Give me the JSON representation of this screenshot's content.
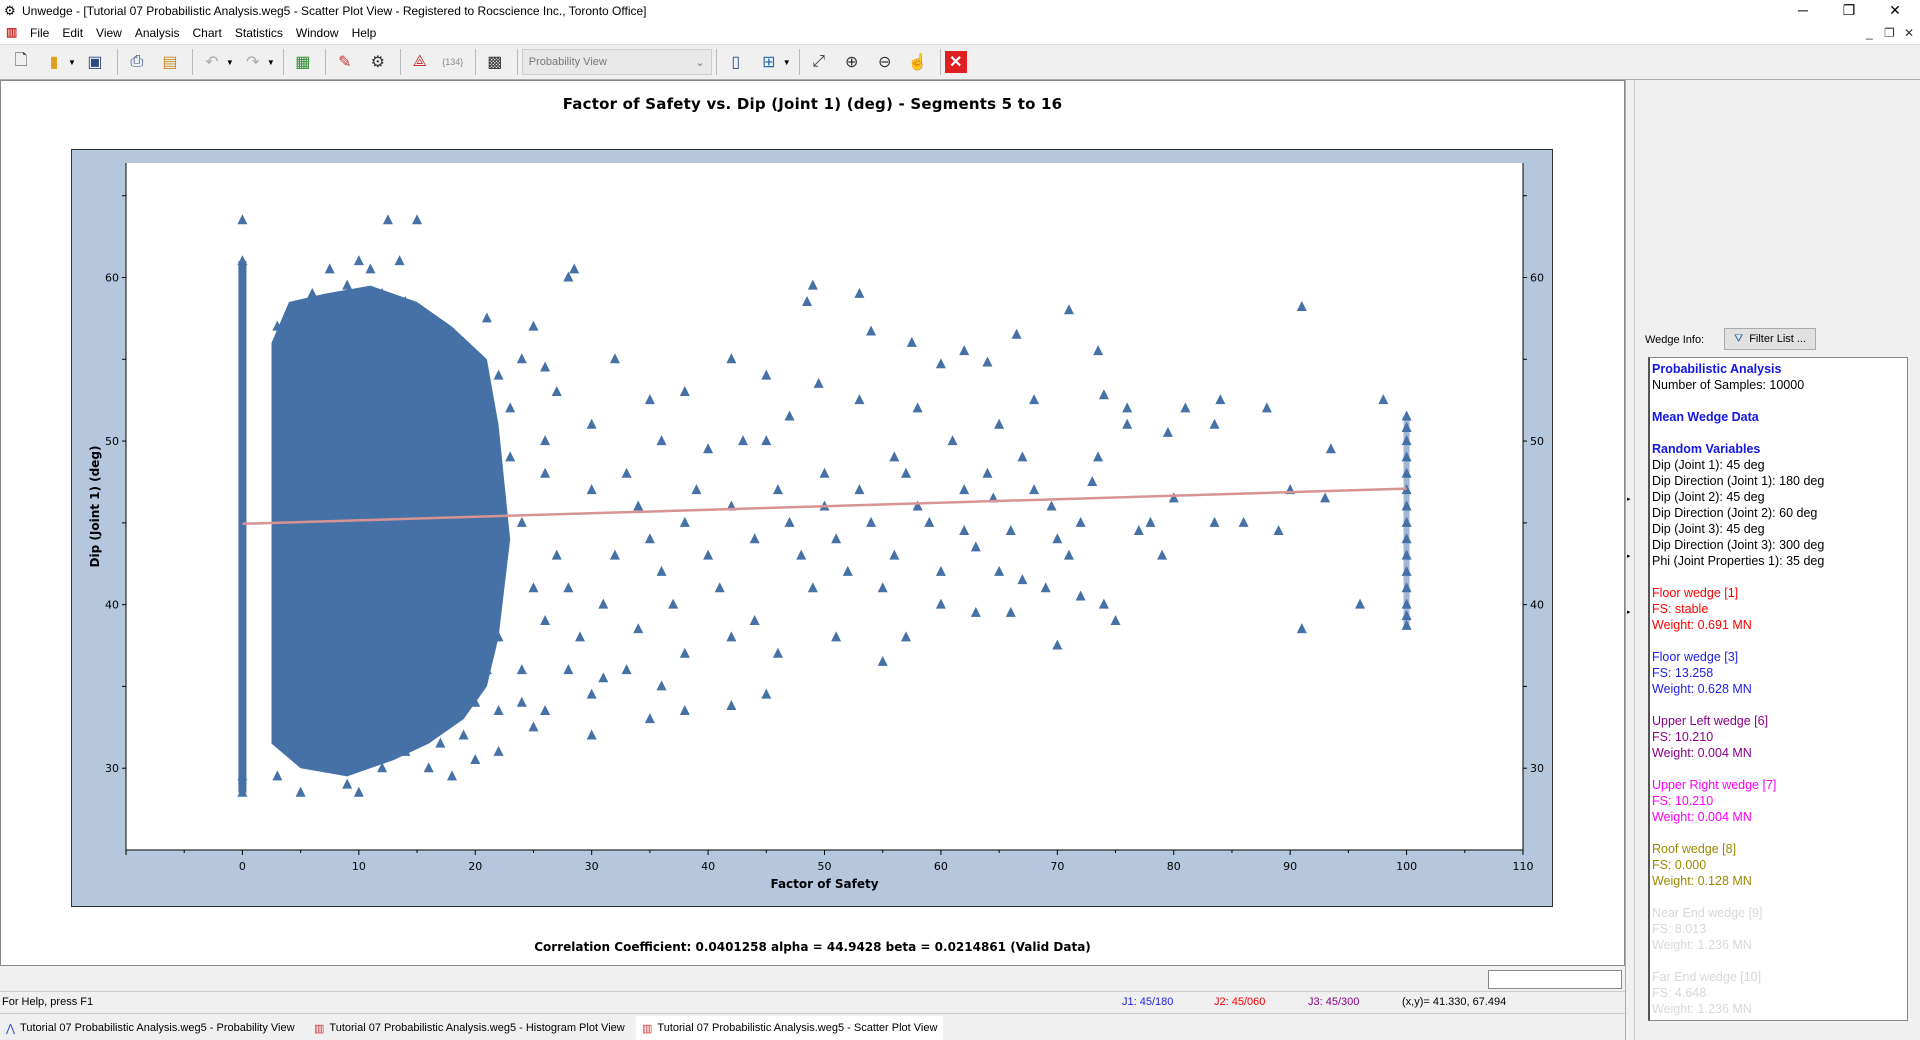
{
  "window": {
    "title": "Unwedge - [Tutorial 07 Probabilistic Analysis.weg5 - Scatter Plot View - Registered to Rocscience Inc., Toronto Office]"
  },
  "menu": [
    "File",
    "Edit",
    "View",
    "Analysis",
    "Chart",
    "Statistics",
    "Window",
    "Help"
  ],
  "toolbar": {
    "view_select": "Probability View"
  },
  "chart_data": {
    "type": "scatter",
    "title": "Factor of Safety  vs. Dip (Joint 1) (deg) - Segments 5 to 16",
    "xlabel": "Factor of Safety",
    "ylabel": "Dip (Joint 1) (deg)",
    "xlim": [
      -10,
      110
    ],
    "ylim": [
      25,
      67
    ],
    "xticks": [
      0,
      10,
      20,
      30,
      40,
      50,
      60,
      70,
      80,
      90,
      100,
      110
    ],
    "yticks": [
      30,
      40,
      50,
      60
    ],
    "grid": false,
    "marker": "triangle",
    "colors": {
      "points": "#4671a6",
      "regression": "#d89494",
      "plot_frame": "#b5c7dc"
    },
    "regression": {
      "alpha": 44.9428,
      "beta": 0.0214861,
      "correlation": 0.0401258
    },
    "points": [
      [
        0,
        63.5
      ],
      [
        12.5,
        63.5
      ],
      [
        15,
        63.5
      ],
      [
        10,
        61
      ],
      [
        11,
        60.5
      ],
      [
        13.5,
        61
      ],
      [
        7.5,
        60.5
      ],
      [
        28.5,
        60.5
      ],
      [
        28,
        60
      ],
      [
        49,
        59.5
      ],
      [
        48.5,
        58.5
      ],
      [
        53,
        59
      ],
      [
        91,
        58.2
      ],
      [
        71,
        58
      ],
      [
        66.5,
        56.5
      ],
      [
        73.5,
        55.5
      ],
      [
        54,
        56.7
      ],
      [
        57.5,
        56
      ],
      [
        62,
        55.5
      ],
      [
        60,
        54.7
      ],
      [
        64,
        54.8
      ],
      [
        49.5,
        53.5
      ],
      [
        45,
        54
      ],
      [
        42,
        55
      ],
      [
        32,
        55
      ],
      [
        24,
        55
      ],
      [
        26,
        54.5
      ],
      [
        38,
        53
      ],
      [
        35,
        52.5
      ],
      [
        47,
        51.5
      ],
      [
        53,
        52.5
      ],
      [
        58,
        52
      ],
      [
        68,
        52.5
      ],
      [
        74,
        52.8
      ],
      [
        76,
        52
      ],
      [
        84,
        52.5
      ],
      [
        81,
        52
      ],
      [
        88,
        52
      ],
      [
        98,
        52.5
      ],
      [
        93.5,
        49.5
      ],
      [
        83.5,
        51
      ],
      [
        79.5,
        50.5
      ],
      [
        73.5,
        49
      ],
      [
        65,
        51
      ],
      [
        61,
        50
      ],
      [
        67,
        49
      ],
      [
        56,
        49
      ],
      [
        50,
        48
      ],
      [
        45,
        50
      ],
      [
        40,
        49.5
      ],
      [
        36,
        50
      ],
      [
        30,
        51
      ],
      [
        26,
        50
      ],
      [
        90,
        47
      ],
      [
        93,
        46.5
      ],
      [
        86,
        45
      ],
      [
        83.5,
        45
      ],
      [
        89,
        44.5
      ],
      [
        78,
        45
      ],
      [
        77,
        44.5
      ],
      [
        79,
        43
      ],
      [
        72,
        45
      ],
      [
        70,
        44
      ],
      [
        66,
        44.5
      ],
      [
        63,
        43.5
      ],
      [
        60,
        42
      ],
      [
        56,
        43
      ],
      [
        52,
        42
      ],
      [
        48,
        43
      ],
      [
        44,
        44
      ],
      [
        40,
        43
      ],
      [
        36,
        42
      ],
      [
        32,
        43
      ],
      [
        28,
        41
      ],
      [
        60,
        40
      ],
      [
        63,
        39.5
      ],
      [
        66,
        39.5
      ],
      [
        67,
        41.5
      ],
      [
        69,
        41
      ],
      [
        72,
        40.5
      ],
      [
        74,
        40
      ],
      [
        75,
        39
      ],
      [
        70,
        37.5
      ],
      [
        57,
        38
      ],
      [
        55,
        36.5
      ],
      [
        51,
        38
      ],
      [
        46,
        37
      ],
      [
        42,
        38
      ],
      [
        38,
        37
      ],
      [
        33,
        36
      ],
      [
        30,
        34.5
      ],
      [
        45,
        34.5
      ],
      [
        42,
        33.8
      ],
      [
        38,
        33.5
      ],
      [
        35,
        33
      ],
      [
        30,
        32
      ],
      [
        25,
        32.5
      ],
      [
        22,
        31
      ],
      [
        18,
        29.5
      ],
      [
        16,
        30
      ],
      [
        10,
        28.5
      ],
      [
        9,
        29
      ],
      [
        5,
        28.5
      ],
      [
        3,
        29.5
      ],
      [
        96,
        40
      ],
      [
        91,
        38.5
      ],
      [
        76,
        51
      ],
      [
        80,
        46.5
      ],
      [
        69.5,
        46
      ],
      [
        64.5,
        46.5
      ],
      [
        62,
        47
      ],
      [
        58,
        46
      ],
      [
        54,
        45
      ],
      [
        50,
        46
      ],
      [
        46,
        47
      ],
      [
        42,
        46
      ],
      [
        38,
        45
      ],
      [
        34,
        46
      ],
      [
        30,
        47
      ],
      [
        26,
        48
      ],
      [
        24,
        45
      ],
      [
        22,
        42
      ],
      [
        22,
        38
      ],
      [
        24,
        36
      ],
      [
        26,
        39
      ],
      [
        20,
        34
      ],
      [
        27,
        43
      ],
      [
        29,
        38
      ],
      [
        31,
        40
      ],
      [
        33,
        48
      ],
      [
        35,
        44
      ],
      [
        37,
        40
      ],
      [
        39,
        47
      ],
      [
        41,
        41
      ],
      [
        43,
        50
      ],
      [
        44,
        39
      ],
      [
        47,
        45
      ],
      [
        49,
        41
      ],
      [
        51,
        44
      ],
      [
        53,
        47
      ],
      [
        55,
        41
      ],
      [
        57,
        48
      ],
      [
        59,
        45
      ],
      [
        62,
        44.5
      ],
      [
        64,
        48
      ],
      [
        65,
        42
      ],
      [
        68,
        47
      ],
      [
        71,
        43
      ],
      [
        73,
        47.5
      ],
      [
        20,
        50
      ],
      [
        21,
        47
      ],
      [
        22,
        54
      ],
      [
        23,
        52
      ],
      [
        25,
        57
      ],
      [
        27,
        53
      ],
      [
        19,
        56
      ],
      [
        21,
        57.5
      ],
      [
        23,
        49
      ],
      [
        25,
        41
      ],
      [
        28,
        36
      ],
      [
        31,
        35.5
      ],
      [
        34,
        38.5
      ],
      [
        36,
        35
      ],
      [
        19,
        38
      ],
      [
        21,
        36
      ],
      [
        24,
        34
      ],
      [
        26,
        33.5
      ],
      [
        19,
        32
      ],
      [
        14,
        31
      ],
      [
        12,
        30
      ],
      [
        7,
        30.5
      ],
      [
        5,
        31
      ],
      [
        17,
        31.5
      ],
      [
        20,
        30.5
      ],
      [
        22,
        33.5
      ],
      [
        3,
        57
      ],
      [
        4,
        58
      ],
      [
        6,
        59
      ],
      [
        8,
        58.5
      ],
      [
        9,
        59.5
      ],
      [
        12,
        59
      ],
      [
        14,
        58.5
      ],
      [
        16,
        57
      ],
      [
        17,
        56
      ],
      [
        18,
        55
      ],
      [
        0,
        61
      ],
      [
        0,
        28.5
      ],
      [
        0,
        29.5
      ],
      [
        100,
        51.5
      ],
      [
        100,
        50.8
      ],
      [
        100,
        50
      ],
      [
        100,
        49
      ],
      [
        100,
        48
      ],
      [
        100,
        47
      ],
      [
        100,
        46
      ],
      [
        100,
        45
      ],
      [
        100,
        44
      ],
      [
        100,
        43
      ],
      [
        100,
        42
      ],
      [
        100,
        41
      ],
      [
        100,
        40
      ],
      [
        100,
        39.3
      ],
      [
        100,
        38.7
      ]
    ]
  },
  "correlation_text": "Correlation Coefficient: 0.0401258 alpha = 44.9428 beta = 0.0214861 (Valid Data)",
  "right_panel": {
    "wedge_info_label": "Wedge Info:",
    "filter_button": "Filter List ...",
    "info": {
      "heading1": "Probabilistic Analysis",
      "samples": "Number of Samples: 10000",
      "heading2": "Mean Wedge Data",
      "heading3": "Random Variables",
      "variables": [
        "Dip (Joint 1): 45 deg",
        "Dip Direction (Joint 1): 180 deg",
        "Dip (Joint 2): 45 deg",
        "Dip Direction (Joint 2): 60 deg",
        "Dip (Joint 3): 45 deg",
        "Dip Direction (Joint 3): 300 deg",
        "Phi (Joint Properties 1): 35 deg"
      ],
      "wedges": [
        {
          "name": "Floor wedge [1]",
          "fs": "FS: stable",
          "weight": "Weight: 0.691 MN",
          "color": "#ff0000"
        },
        {
          "name": "Floor wedge [3]",
          "fs": "FS: 13.258",
          "weight": "Weight: 0.628 MN",
          "color": "#1e1ee8"
        },
        {
          "name": "Upper Left wedge [6]",
          "fs": "FS: 10.210",
          "weight": "Weight: 0.004 MN",
          "color": "#8b008b"
        },
        {
          "name": "Upper Right wedge [7]",
          "fs": "FS: 10.210",
          "weight": "Weight: 0.004 MN",
          "color": "#ff00ff"
        },
        {
          "name": "Roof wedge [8]",
          "fs": "FS: 0.000",
          "weight": "Weight: 0.128 MN",
          "color": "#9a8a00"
        },
        {
          "name": "Near End wedge [9]",
          "fs": "FS: 8.013",
          "weight": "Weight: 1.236 MN",
          "color": "#d8d8d8"
        },
        {
          "name": "Far End wedge [10]",
          "fs": "FS: 4.648",
          "weight": "Weight: 1.236 MN",
          "color": "#d8d8d8"
        }
      ]
    }
  },
  "status": {
    "help": "For Help, press F1",
    "j1": "J1: 45/180",
    "j2": "J2: 45/060",
    "j3": "J3: 45/300",
    "xy": "(x,y)= 41.330, 67.494"
  },
  "tabs": [
    {
      "label": "Tutorial 07 Probabilistic Analysis.weg5 - Probability View",
      "active": false
    },
    {
      "label": "Tutorial 07 Probabilistic Analysis.weg5 - Histogram Plot View",
      "active": false
    },
    {
      "label": "Tutorial 07 Probabilistic Analysis.weg5 - Scatter Plot View",
      "active": true
    }
  ]
}
